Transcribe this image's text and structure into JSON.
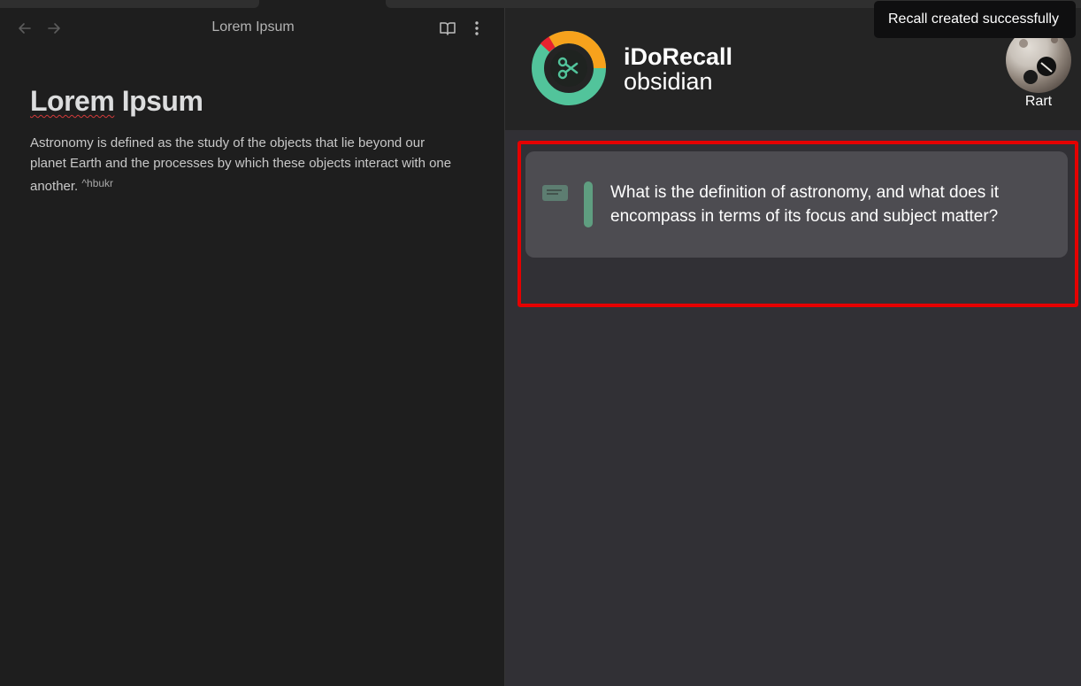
{
  "note": {
    "header_title": "Lorem Ipsum",
    "title_word_1": "Lorem",
    "title_word_2": "Ipsum",
    "body": "Astronomy is defined as the study of the objects that lie beyond our planet Earth and the processes by which these objects interact with one another.",
    "block_ref": "^hbukr"
  },
  "recall_panel": {
    "brand_name": "iDoRecall",
    "brand_sub": "obsidian",
    "user_name": "Rart",
    "card_question": "What is the definition of astronomy, and what does it encompass in terms of its focus and subject matter?"
  },
  "toast": {
    "message": "Recall created successfully"
  },
  "icons": {
    "nav_back": "arrow-left-icon",
    "nav_forward": "arrow-right-icon",
    "reading_view": "book-open-icon",
    "more_options": "more-vertical-icon",
    "card_type": "message-lines-icon",
    "logo": "scissors-icon"
  },
  "colors": {
    "highlight_border": "#e50000",
    "card_bar": "#5f9e80",
    "logo_green": "#52c49b",
    "logo_orange": "#f7a21c",
    "logo_red": "#e8222e"
  }
}
